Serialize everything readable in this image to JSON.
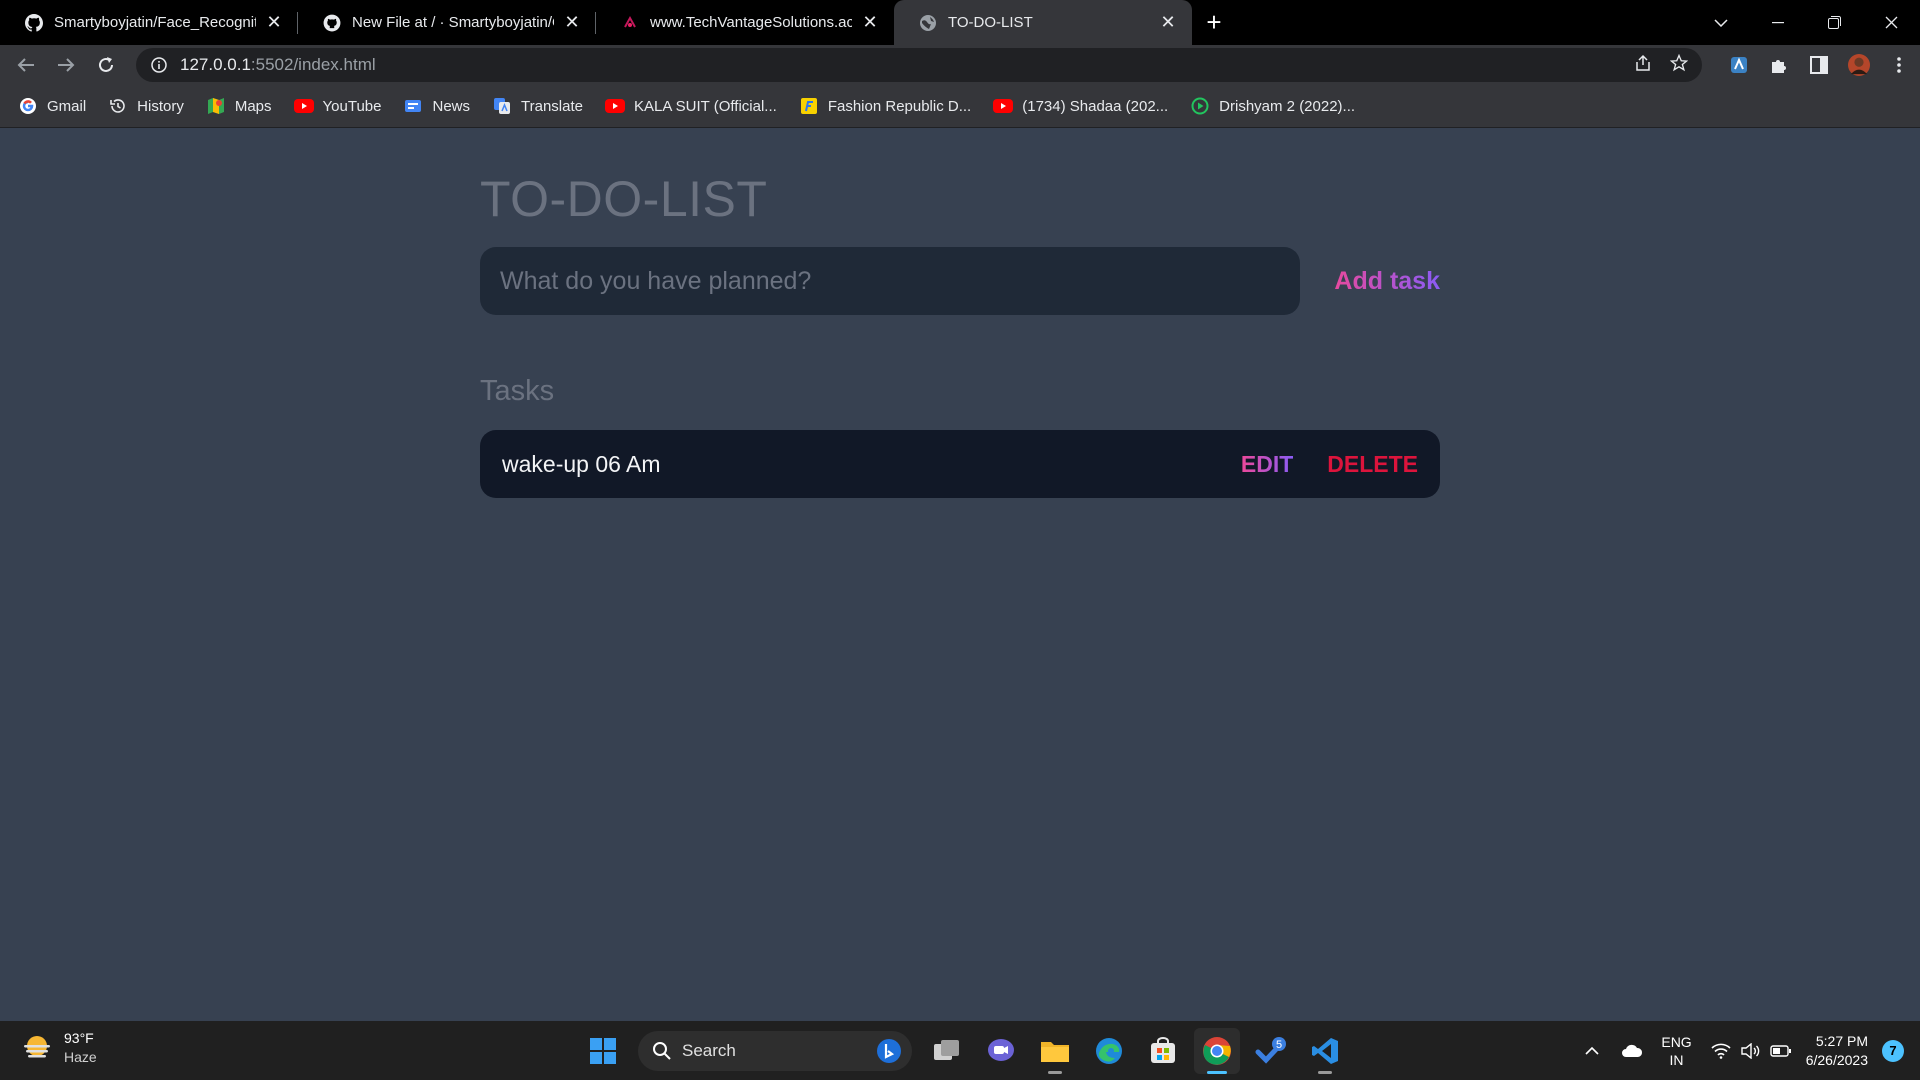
{
  "browser": {
    "tabs": [
      {
        "title": "Smartyboyjatin/Face_Recognition",
        "icon": "github-icon",
        "active": false
      },
      {
        "title": "New File at / · Smartyboyjatin/OC",
        "icon": "github-icon",
        "active": false
      },
      {
        "title": "www.TechVantageSolutions.ac.in",
        "icon": "site-icon",
        "active": false
      },
      {
        "title": "TO-DO-LIST",
        "icon": "globe-icon",
        "active": true
      }
    ],
    "url_host": "127.0.0.1",
    "url_path": ":5502/index.html",
    "bookmarks": [
      {
        "label": "Gmail",
        "icon": "google-icon"
      },
      {
        "label": "History",
        "icon": "history-icon"
      },
      {
        "label": "Maps",
        "icon": "maps-icon"
      },
      {
        "label": "YouTube",
        "icon": "youtube-icon"
      },
      {
        "label": "News",
        "icon": "news-icon"
      },
      {
        "label": "Translate",
        "icon": "translate-icon"
      },
      {
        "label": "KALA SUIT (Official...",
        "icon": "youtube-icon"
      },
      {
        "label": "Fashion Republic D...",
        "icon": "flipkart-icon"
      },
      {
        "label": "(1734) Shadaa (202...",
        "icon": "youtube-icon"
      },
      {
        "label": "Drishyam 2 (2022)...",
        "icon": "play-icon"
      }
    ]
  },
  "app": {
    "title": "TO-DO-LIST",
    "input_placeholder": "What do you have planned?",
    "add_button": "Add task",
    "tasks_heading": "Tasks",
    "tasks": [
      {
        "text": "wake-up 06 Am",
        "edit_label": "EDIT",
        "delete_label": "DELETE"
      }
    ]
  },
  "taskbar": {
    "weather_temp": "93°F",
    "weather_condition": "Haze",
    "search_label": "Search",
    "lang_line1": "ENG",
    "lang_line2": "IN",
    "time": "5:27 PM",
    "date": "6/26/2023",
    "notification_count": "7",
    "todo_badge": "5"
  },
  "colors": {
    "page_bg": "#374151",
    "input_bg": "#1f2937",
    "task_bg": "#111827",
    "accent_pink": "#ec4899",
    "accent_purple": "#8b5cf6",
    "delete_red": "#dc143c"
  }
}
